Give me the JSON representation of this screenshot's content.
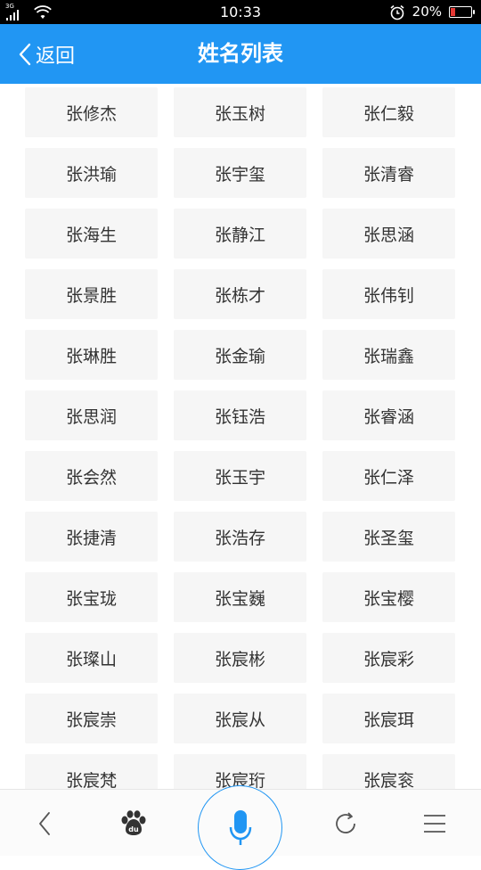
{
  "status_bar": {
    "network": "3G",
    "time": "10:33",
    "battery_text": "20%",
    "battery_level": 0.2,
    "alarm_icon": "alarm-clock-icon"
  },
  "header": {
    "back_label": "返回",
    "title": "姓名列表"
  },
  "names": [
    "张修杰",
    "张玉树",
    "张仁毅",
    "张洪瑜",
    "张宇玺",
    "张清睿",
    "张海生",
    "张静江",
    "张思涵",
    "张景胜",
    "张栋才",
    "张伟钊",
    "张琳胜",
    "张金瑜",
    "张瑞鑫",
    "张思润",
    "张钰浩",
    "张睿涵",
    "张会然",
    "张玉宇",
    "张仁泽",
    "张捷清",
    "张浩存",
    "张圣玺",
    "张宝珑",
    "张宝巍",
    "张宝樱",
    "张璨山",
    "张宸彬",
    "张宸彩",
    "张宸崇",
    "张宸从",
    "张宸珥",
    "张宸梵",
    "张宸珩",
    "张宸衮"
  ],
  "bottom_nav": {
    "back_icon": "chevron-left-icon",
    "baidu_icon": "baidu-paw-icon",
    "baidu_icon_text": "du",
    "mic_icon": "microphone-icon",
    "refresh_icon": "refresh-icon",
    "menu_icon": "menu-icon"
  },
  "colors": {
    "accent": "#2196f3",
    "status_bar": "#000000",
    "cell_background": "#f6f6f6",
    "battery_low": "#e53935"
  }
}
